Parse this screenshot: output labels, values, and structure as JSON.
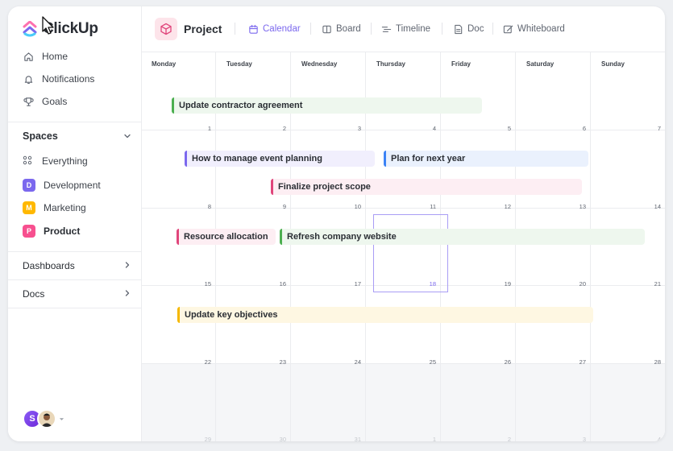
{
  "sidebar": {
    "logo_text": "ClickUp",
    "nav": [
      {
        "label": "Home",
        "icon": "home-icon"
      },
      {
        "label": "Notifications",
        "icon": "bell-icon"
      },
      {
        "label": "Goals",
        "icon": "trophy-icon"
      }
    ],
    "spaces_title": "Spaces",
    "everything_label": "Everything",
    "spaces": [
      {
        "letter": "D",
        "label": "Development",
        "color": "#7b68ee"
      },
      {
        "letter": "M",
        "label": "Marketing",
        "color": "#ffb800"
      },
      {
        "letter": "P",
        "label": "Product",
        "color": "#f7508f"
      }
    ],
    "dashboards_label": "Dashboards",
    "docs_label": "Docs",
    "avatar_letter": "S"
  },
  "header": {
    "project_title": "Project",
    "tabs": [
      {
        "label": "Calendar",
        "icon": "calendar-icon",
        "active": true
      },
      {
        "label": "Board",
        "icon": "board-icon",
        "active": false
      },
      {
        "label": "Timeline",
        "icon": "timeline-icon",
        "active": false
      },
      {
        "label": "Doc",
        "icon": "doc-icon",
        "active": false
      },
      {
        "label": "Whiteboard",
        "icon": "whiteboard-icon",
        "active": false
      }
    ]
  },
  "calendar": {
    "weekdays": [
      "Monday",
      "Tuesday",
      "Wednesday",
      "Thursday",
      "Friday",
      "Saturday",
      "Sunday"
    ],
    "weeks": [
      [
        "1",
        "2",
        "3",
        "4",
        "5",
        "6",
        "7"
      ],
      [
        "8",
        "9",
        "10",
        "11",
        "12",
        "13",
        "14"
      ],
      [
        "15",
        "16",
        "17",
        "18",
        "19",
        "20",
        "21"
      ],
      [
        "22",
        "23",
        "24",
        "25",
        "26",
        "27",
        "28"
      ],
      [
        "29",
        "30",
        "31",
        "1",
        "2",
        "3",
        "4"
      ]
    ],
    "today": "18",
    "events": [
      {
        "label": "Update contractor agreement",
        "color": "#4caf50",
        "bg": "#eef7ee"
      },
      {
        "label": "How to manage event planning",
        "color": "#7b68ee",
        "bg": "#f1effd"
      },
      {
        "label": "Plan for next year",
        "color": "#3b82f6",
        "bg": "#eaf1fd"
      },
      {
        "label": "Finalize project scope",
        "color": "#e0457b",
        "bg": "#fdeef3"
      },
      {
        "label": "Resource allocation",
        "color": "#e0457b",
        "bg": "#fdeef3"
      },
      {
        "label": "Refresh company website",
        "color": "#4caf50",
        "bg": "#eef7ee"
      },
      {
        "label": "Update key objectives",
        "color": "#f5b800",
        "bg": "#fef7e2"
      }
    ]
  }
}
